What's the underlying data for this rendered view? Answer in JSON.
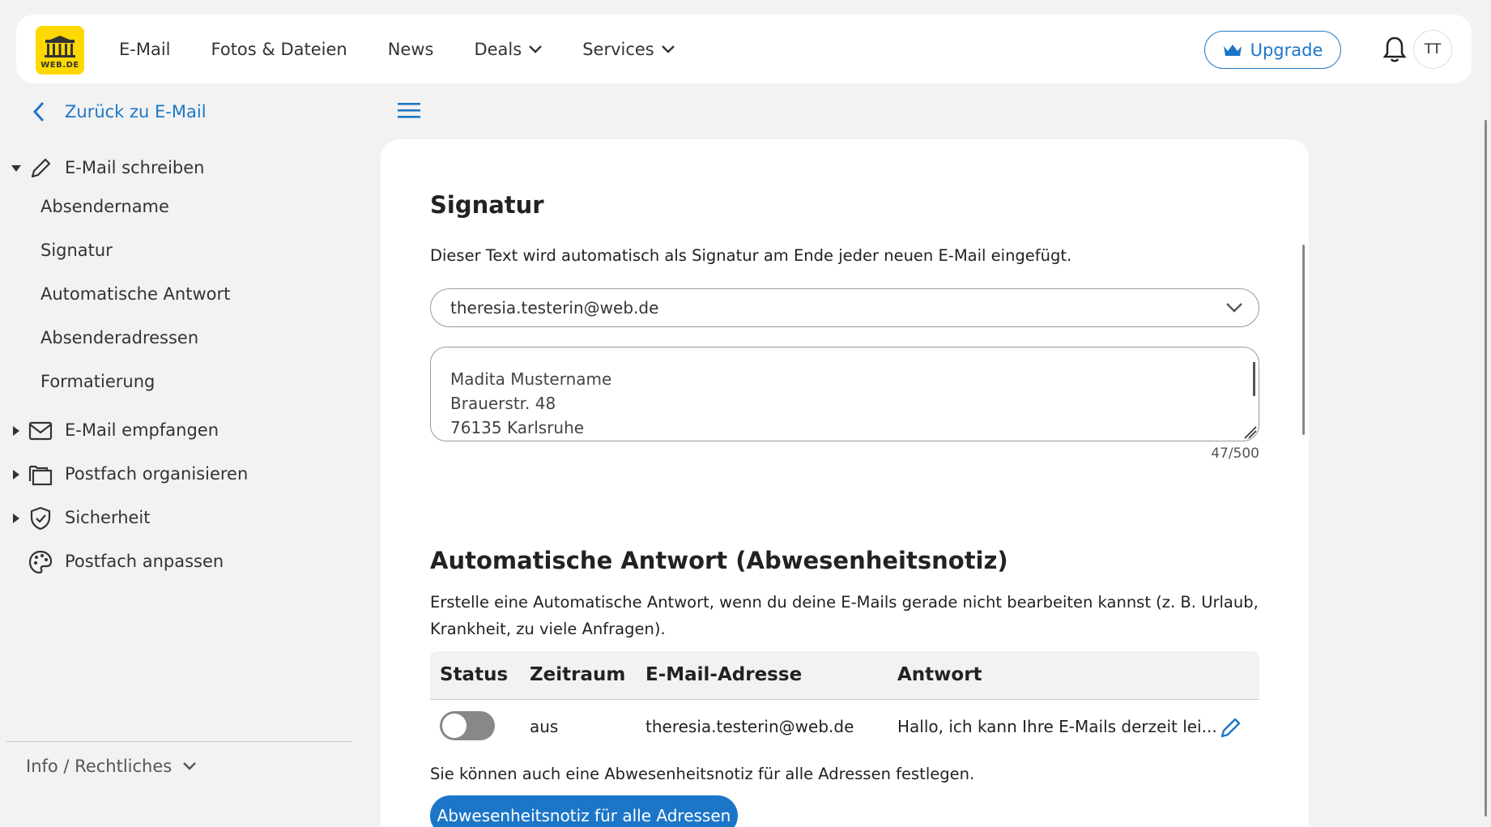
{
  "header": {
    "logo_text": "WEB.DE",
    "nav": [
      {
        "label": "E-Mail",
        "dropdown": false
      },
      {
        "label": "Fotos & Dateien",
        "dropdown": false
      },
      {
        "label": "News",
        "dropdown": false
      },
      {
        "label": "Deals",
        "dropdown": true
      },
      {
        "label": "Services",
        "dropdown": true
      }
    ],
    "upgrade_label": "Upgrade",
    "avatar_initials": "TT",
    "colors": {
      "accent": "#1c76c8",
      "logo_bg": "#ffd800"
    }
  },
  "sidebar": {
    "back_label": "Zurück zu E-Mail",
    "sections": [
      {
        "label": "E-Mail schreiben",
        "icon": "pencil-icon",
        "expanded": true,
        "items": [
          "Absendername",
          "Signatur",
          "Automatische Antwort",
          "Absenderadressen",
          "Formatierung"
        ]
      },
      {
        "label": "E-Mail empfangen",
        "icon": "envelope-icon",
        "expanded": false
      },
      {
        "label": "Postfach organisieren",
        "icon": "folders-icon",
        "expanded": false
      },
      {
        "label": "Sicherheit",
        "icon": "shield-icon",
        "expanded": false
      },
      {
        "label": "Postfach anpassen",
        "icon": "palette-icon",
        "expanded": false
      }
    ],
    "info_label": "Info / Rechtliches"
  },
  "signatur": {
    "title": "Signatur",
    "description": "Dieser Text wird automatisch als Signatur am Ende jeder neuen E-Mail eingefügt.",
    "selected_address": "theresia.testerin@web.de",
    "lines": [
      "Madita Mustername",
      "Brauerstr. 48",
      "76135 Karlsruhe"
    ],
    "counter": "47/500"
  },
  "auto_reply": {
    "title": "Automatische Antwort (Abwesenheitsnotiz)",
    "description_line1": "Erstelle eine Automatische Antwort, wenn du deine E-Mails gerade nicht bearbeiten kannst (z. B. Urlaub,",
    "description_line2": "Krankheit, zu viele Anfragen).",
    "columns": {
      "status": "Status",
      "period": "Zeitraum",
      "address": "E-Mail-Adresse",
      "reply": "Antwort"
    },
    "row": {
      "status_on": false,
      "period": "aus",
      "address": "theresia.testerin@web.de",
      "reply": "Hallo, ich kann Ihre E-Mails derzeit lei..."
    },
    "note": "Sie können auch eine Abwesenheitsnotiz für alle Adressen festlegen.",
    "button_label": "Abwesenheitsnotiz für alle Adressen"
  }
}
